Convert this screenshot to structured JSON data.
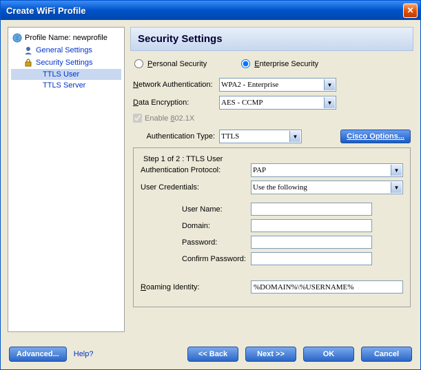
{
  "window": {
    "title": "Create WiFi Profile"
  },
  "tree": {
    "root": "Profile Name: newprofile",
    "general": "General Settings",
    "security": "Security Settings",
    "ttls_user": "TTLS User",
    "ttls_server": "TTLS Server"
  },
  "page": {
    "heading": "Security Settings",
    "radio": {
      "personal_prefix": "P",
      "personal_rest": "ersonal Security",
      "enterprise_prefix": "E",
      "enterprise_rest": "nterprise Security"
    },
    "netauth_label_prefix": "N",
    "netauth_label_rest": "etwork Authentication:",
    "netauth_value": "WPA2 - Enterprise",
    "dataenc_label_prefix": "D",
    "dataenc_label_rest": "ata Encryption:",
    "dataenc_value": "AES - CCMP",
    "enable8021x_prefix": "Enable ",
    "enable8021x_u": "8",
    "enable8021x_rest": "02.1X",
    "authtype_label": "Authentication Type:",
    "authtype_value": "TTLS",
    "cisco_btn_prefix": "C",
    "cisco_btn_rest": "isco Options...",
    "step_legend": "Step 1 of 2 : TTLS User",
    "authproto_label": "Authentication Protocol:",
    "authproto_value": "PAP",
    "usercred_label": "User Credentials:",
    "usercred_value": "Use the following",
    "username_label": "User Name:",
    "username_value": "",
    "domain_label": "Domain:",
    "domain_value": "",
    "password_label": "Password:",
    "password_value": "",
    "confirmpw_label": "Confirm Password:",
    "confirmpw_value": "",
    "roaming_label_prefix": "R",
    "roaming_label_rest": "oaming Identity:",
    "roaming_value": "%DOMAIN%\\%USERNAME%"
  },
  "footer": {
    "advanced": "Advanced...",
    "help": "Help?",
    "back": "<<  Back",
    "next": "Next  >>",
    "ok": "OK",
    "cancel": "Cancel"
  }
}
